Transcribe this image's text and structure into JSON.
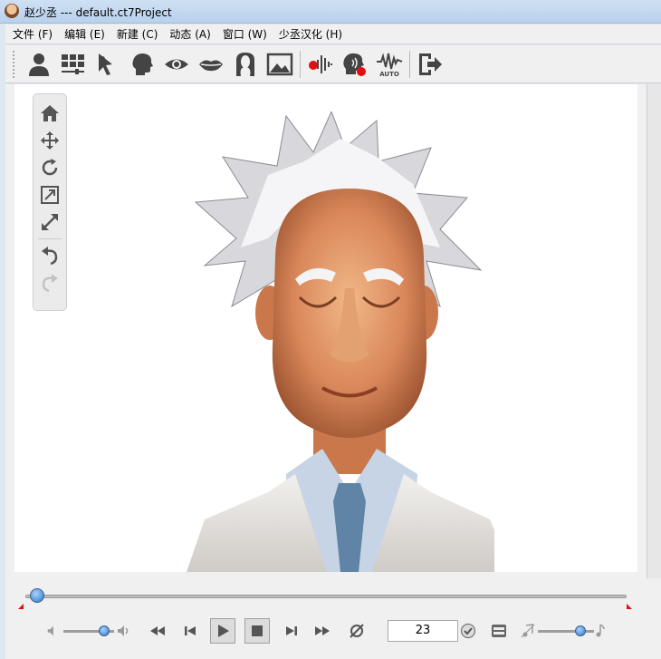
{
  "window": {
    "title": "赵少丞 --- default.ct7Project"
  },
  "menu": [
    "文件 (F)",
    "编辑 (E)",
    "新建 (C)",
    "动态 (A)",
    "窗口 (W)",
    "少丞汉化 (H)"
  ],
  "toolbar": {
    "icons": [
      "actor-icon",
      "scene-grid-icon",
      "select-pointer-icon",
      "head-icon",
      "eye-icon",
      "lips-icon",
      "face-mask-icon",
      "image-icon",
      "record-audio-icon",
      "record-face-icon",
      "auto-lipsync-icon",
      "exit-icon"
    ],
    "auto_label": "AUTO"
  },
  "view_tools": [
    "home-icon",
    "move-icon",
    "rotate-icon",
    "zoom-fit-icon",
    "expand-icon",
    "undo-icon",
    "redo-icon"
  ],
  "timeline": {
    "frame": "23",
    "progress": 0.02,
    "volume": 0.8,
    "speed": 0.75
  },
  "colors": {
    "accent": "#2a76c6",
    "marker": "#dd1111"
  }
}
